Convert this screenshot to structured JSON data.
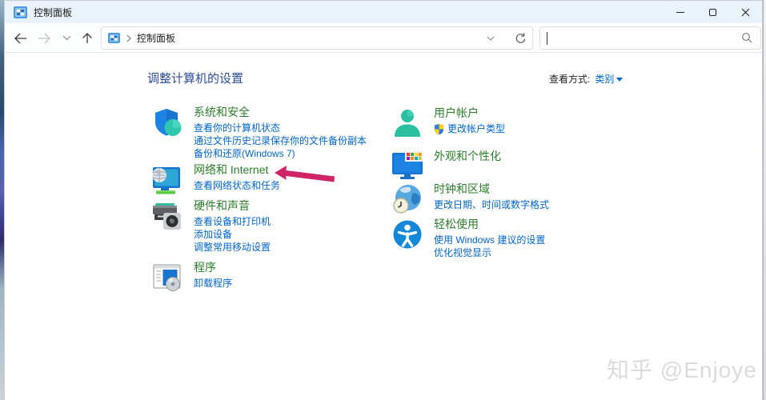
{
  "window": {
    "title": "控制面板"
  },
  "navbar": {
    "breadcrumb": "控制面板",
    "search_value": ""
  },
  "main": {
    "heading": "调整计算机的设置",
    "view_by_label": "查看方式:",
    "view_by_value": "类别"
  },
  "categories": {
    "left": [
      {
        "title": "系统和安全",
        "icon": "shield-icon",
        "links": [
          "查看你的计算机状态",
          "通过文件历史记录保存你的文件备份副本",
          "备份和还原(Windows 7)"
        ]
      },
      {
        "title": "网络和 Internet",
        "icon": "network-monitor-icon",
        "links": [
          "查看网络状态和任务"
        ]
      },
      {
        "title": "硬件和声音",
        "icon": "printer-speaker-icon",
        "links": [
          "查看设备和打印机",
          "添加设备",
          "调整常用移动设置"
        ]
      },
      {
        "title": "程序",
        "icon": "programs-disc-icon",
        "links": [
          "卸载程序"
        ]
      }
    ],
    "right": [
      {
        "title": "用户帐户",
        "icon": "user-silhouette-icon",
        "links": [
          "更改帐户类型"
        ]
      },
      {
        "title": "外观和个性化",
        "icon": "personalization-monitor-icon",
        "links": []
      },
      {
        "title": "时钟和区域",
        "icon": "globe-clock-icon",
        "links": [
          "更改日期、时间或数字格式"
        ]
      },
      {
        "title": "轻松使用",
        "icon": "accessibility-icon",
        "links": [
          "使用 Windows 建议的设置",
          "优化视觉显示"
        ]
      }
    ]
  },
  "annotation": {
    "arrow_color": "#d02468"
  },
  "watermark": {
    "text": "知乎 @Enjoye"
  },
  "colors": {
    "category_title_green": "#2b7d2b",
    "link_blue": "#0066cc",
    "heading_navy": "#2e4d97",
    "titlebar_bg": "#eaf3fb",
    "watermark_gray": "#dbdbdb"
  }
}
